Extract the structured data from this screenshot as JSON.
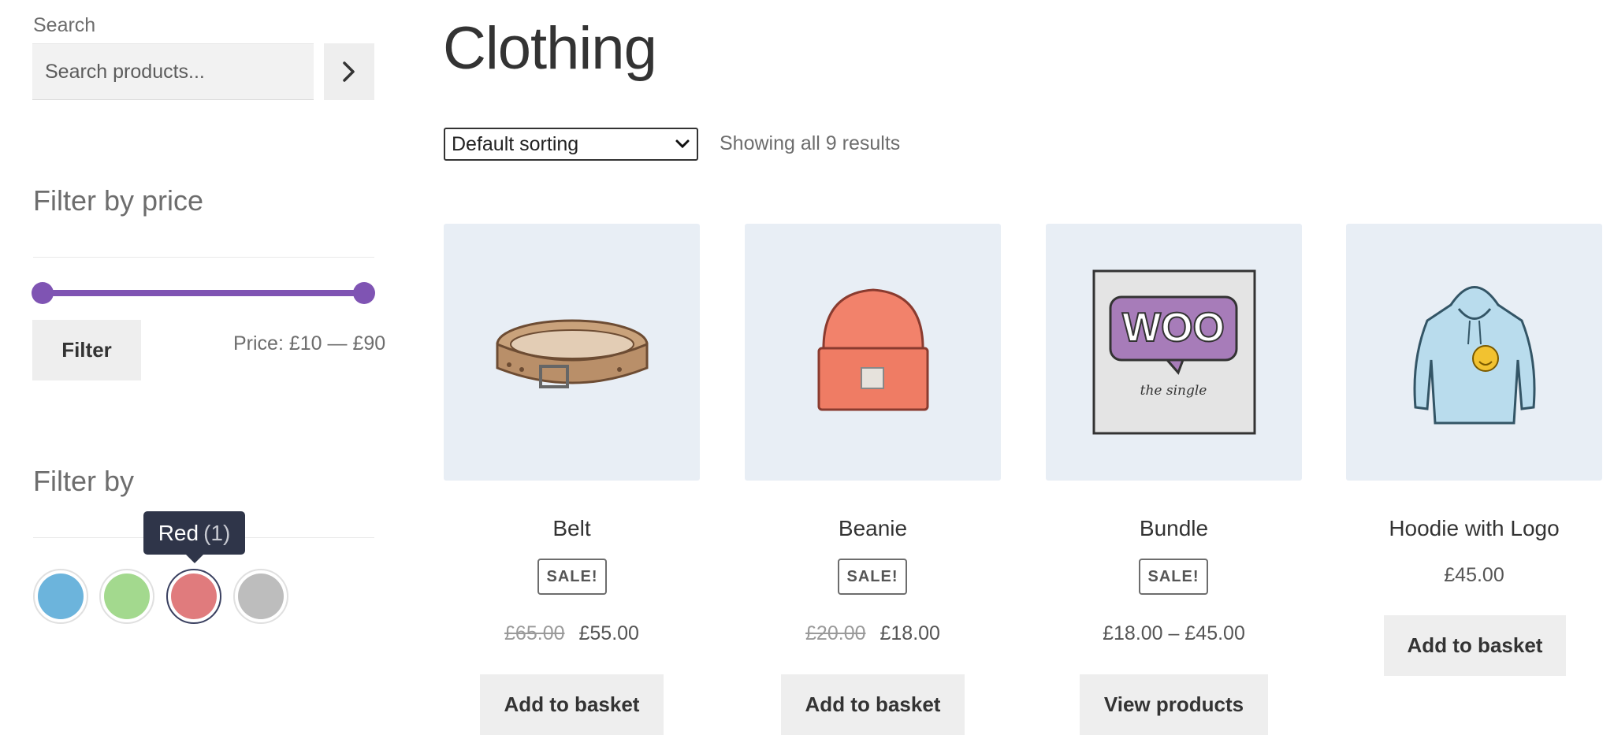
{
  "sidebar": {
    "search": {
      "label": "Search",
      "placeholder": "Search products...",
      "submit_icon": "chevron-right-icon"
    },
    "price_filter": {
      "title": "Filter by price",
      "button_label": "Filter",
      "range_label": "Price: £10 — £90",
      "min_value": 10,
      "max_value": 90,
      "slider_color": "#7f54b3"
    },
    "attribute_filter": {
      "title": "Filter by",
      "swatches": [
        {
          "name": "Blue",
          "color": "#6cb4dc",
          "active": false
        },
        {
          "name": "Green",
          "color": "#a3d98e",
          "active": false
        },
        {
          "name": "Red",
          "color": "#e07b7d",
          "active": true
        },
        {
          "name": "Gray",
          "color": "#bdbdbd",
          "active": false
        }
      ],
      "tooltip": {
        "label": "Red",
        "count": "(1)"
      }
    }
  },
  "main": {
    "title": "Clothing",
    "sorting": {
      "selected": "Default sorting"
    },
    "result_count": "Showing all 9 results",
    "products": [
      {
        "name": "Belt",
        "sale_badge": "SALE!",
        "old_price": "£65.00",
        "price": "£55.00",
        "button": "Add to basket",
        "image_icon": "belt-image"
      },
      {
        "name": "Beanie",
        "sale_badge": "SALE!",
        "old_price": "£20.00",
        "price": "£18.00",
        "button": "Add to basket",
        "image_icon": "beanie-image"
      },
      {
        "name": "Bundle",
        "sale_badge": "SALE!",
        "price": "£18.00 – £45.00",
        "button": "View products",
        "image_icon": "woo-album-image",
        "image_text": "WOO",
        "image_subtext": "the single"
      },
      {
        "name": "Hoodie with Logo",
        "price": "£45.00",
        "button": "Add to basket",
        "image_icon": "hoodie-image"
      }
    ]
  }
}
